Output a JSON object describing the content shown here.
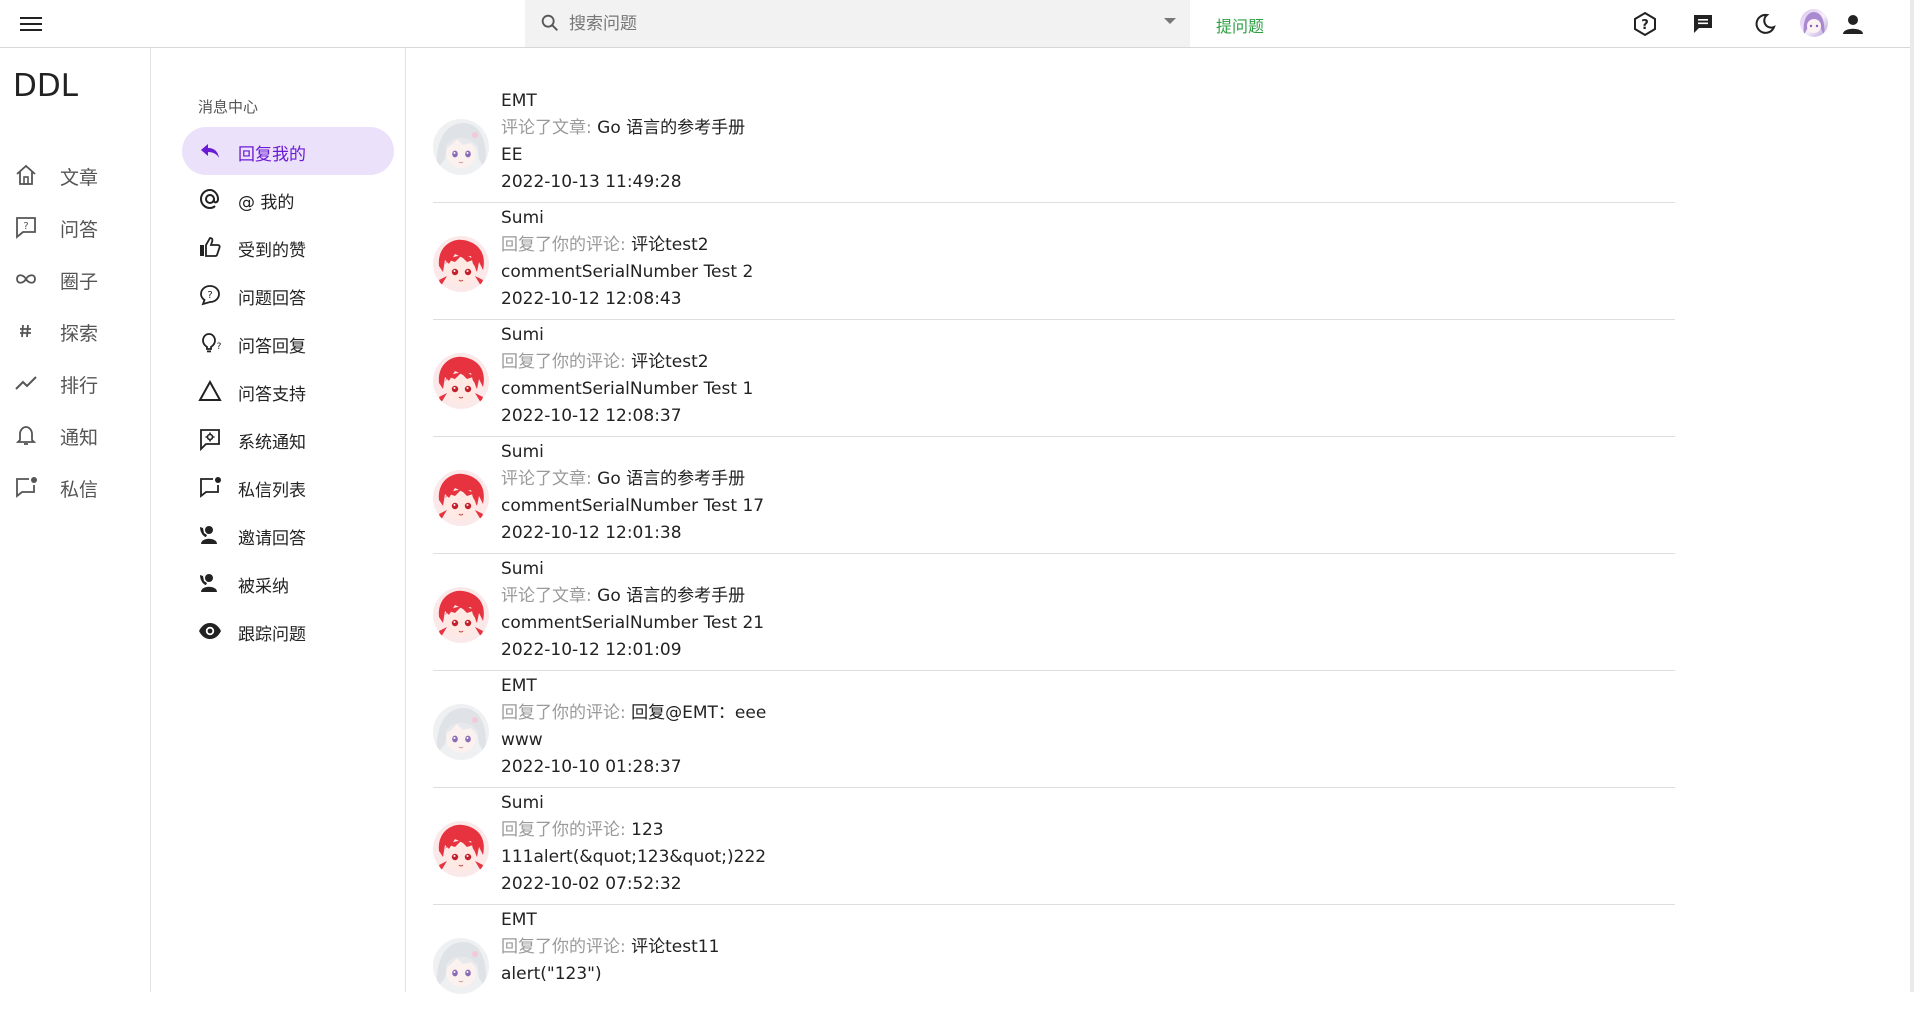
{
  "topbar": {
    "search_placeholder": "搜索问题",
    "ask_label": "提问题"
  },
  "brand": "DDL",
  "rail": {
    "items": [
      {
        "label": "文章",
        "icon": "home-icon"
      },
      {
        "label": "问答",
        "icon": "question-chat-icon"
      },
      {
        "label": "圈子",
        "icon": "infinity-icon"
      },
      {
        "label": "探索",
        "icon": "hashtag-icon"
      },
      {
        "label": "排行",
        "icon": "trending-icon"
      },
      {
        "label": "通知",
        "icon": "bell-icon"
      },
      {
        "label": "私信",
        "icon": "message-icon"
      }
    ]
  },
  "message_nav": {
    "title": "消息中心",
    "items": [
      {
        "label": "回复我的",
        "icon": "reply-icon",
        "active": true
      },
      {
        "label": "@ 我的",
        "icon": "at-icon"
      },
      {
        "label": "受到的赞",
        "icon": "thumbs-up-icon"
      },
      {
        "label": "问题回答",
        "icon": "question-chat-icon"
      },
      {
        "label": "问答回复",
        "icon": "lightbulb-question-icon"
      },
      {
        "label": "问答支持",
        "icon": "triangle-icon"
      },
      {
        "label": "系统通知",
        "icon": "settings-message-icon"
      },
      {
        "label": "私信列表",
        "icon": "message-badge-icon"
      },
      {
        "label": "邀请回答",
        "icon": "person-phone-icon"
      },
      {
        "label": "被采纳",
        "icon": "person-phone-icon"
      },
      {
        "label": "跟踪问题",
        "icon": "eye-icon"
      }
    ]
  },
  "feed": [
    {
      "name": "EMT",
      "action": "评论了文章:",
      "target": "Go 语言的参考手册",
      "content": "EE",
      "time": "2022-10-13 11:49:28",
      "avatar": "white"
    },
    {
      "name": "Sumi",
      "action": "回复了你的评论:",
      "target": "评论test2",
      "content": "commentSerialNumber Test 2",
      "time": "2022-10-12 12:08:43",
      "avatar": "red"
    },
    {
      "name": "Sumi",
      "action": "回复了你的评论:",
      "target": "评论test2",
      "content": "commentSerialNumber Test 1",
      "time": "2022-10-12 12:08:37",
      "avatar": "red"
    },
    {
      "name": "Sumi",
      "action": "评论了文章:",
      "target": "Go 语言的参考手册",
      "content": "commentSerialNumber Test 17",
      "time": "2022-10-12 12:01:38",
      "avatar": "red"
    },
    {
      "name": "Sumi",
      "action": "评论了文章:",
      "target": "Go 语言的参考手册",
      "content": "commentSerialNumber Test 21",
      "time": "2022-10-12 12:01:09",
      "avatar": "red"
    },
    {
      "name": "EMT",
      "action": "回复了你的评论:",
      "target": "回复@EMT：eee",
      "content": "www",
      "time": "2022-10-10 01:28:37",
      "avatar": "white"
    },
    {
      "name": "Sumi",
      "action": "回复了你的评论:",
      "target": "123",
      "content": "111alert(&quot;123&quot;)222",
      "time": "2022-10-02 07:52:32",
      "avatar": "red"
    },
    {
      "name": "EMT",
      "action": "回复了你的评论:",
      "target": "评论test11",
      "content": "alert(\"123\")",
      "time": "",
      "avatar": "white"
    }
  ],
  "colors": {
    "accent": "#6a1bd4",
    "active_bg": "#ece1fa",
    "ask_green": "#2ea043",
    "muted": "#9a9a9a"
  }
}
